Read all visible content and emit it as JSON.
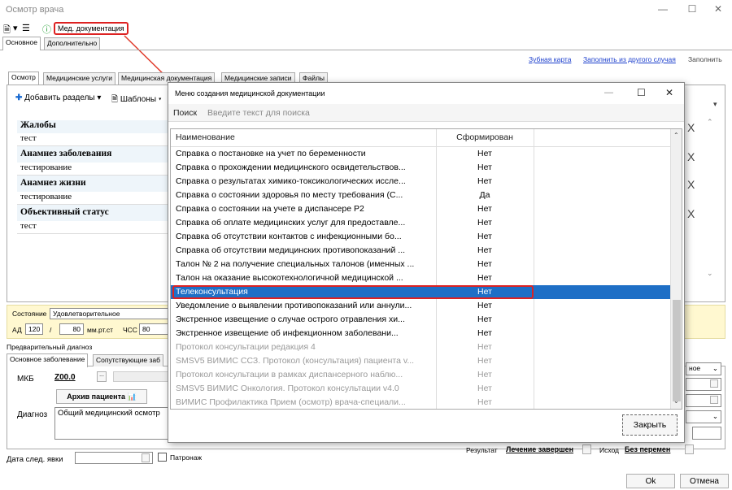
{
  "window": {
    "title": "Осмотр врача"
  },
  "toolbar": {
    "med_docs_label": "Мед. документация"
  },
  "main_tabs": [
    "Основное",
    "Дополнительно"
  ],
  "links": {
    "dental_map": "Зубная карта",
    "fill_from_other": "Заполнить из другого случая",
    "fill": "Заполнить"
  },
  "inner_tabs": [
    "Осмотр",
    "Медицинские услуги",
    "Медицинская документация",
    "Медицинские записи",
    "Файлы"
  ],
  "form_toolbar": {
    "add_sections": "Добавить разделы",
    "templates": "Шаблоны"
  },
  "sections": [
    {
      "head": "Жалобы",
      "value": "тест"
    },
    {
      "head": "Анамнез заболевания",
      "value": "тестирование"
    },
    {
      "head": "Анамнез жизни",
      "value": "тестирование"
    },
    {
      "head": "Объективный статус",
      "value": "тест"
    }
  ],
  "state": {
    "label": "Состояние",
    "value": "Удовлетворительное",
    "ad_label": "АД",
    "ad_sys": "120",
    "ad_sep": "/",
    "ad_dia": "80",
    "unit": "мм.рт.ст",
    "chss_label": "ЧСС",
    "chss_value": "80"
  },
  "diagnosis": {
    "title": "Предварительный диагноз",
    "tabs": [
      "Основное заболевание",
      "Сопутствующие заб"
    ],
    "mkb_label": "МКБ",
    "mkb_value": "Z00.0",
    "archive_button": "Архив пациента",
    "diag_label": "Диагноз",
    "diag_value": "Общий медицинский осмотр"
  },
  "right_panel": {
    "select_value": "ное"
  },
  "footer": {
    "next_visit_label": "Дата след. явки",
    "patronage_label": "Патронаж",
    "result_label": "Результат",
    "result_value": "Лечение завершен",
    "outcome_label": "Исход",
    "outcome_value": "Без перемен",
    "ok": "Ok",
    "cancel": "Отмена"
  },
  "dialog": {
    "title": "Меню создания медицинской документации",
    "search_label": "Поиск",
    "search_placeholder": "Введите текст для поиска",
    "col_name": "Наименование",
    "col_formed": "Сформирован",
    "close_button": "Закрыть",
    "rows": [
      {
        "name": "Справка о постановке на учет по беременности",
        "formed": "Нет"
      },
      {
        "name": "Справка о прохождении медицинского освидетельствов...",
        "formed": "Нет"
      },
      {
        "name": "Справка о результатах химико-токсикологических иссле...",
        "formed": "Нет"
      },
      {
        "name": "Справка о состоянии здоровья по месту требования (С...",
        "formed": "Да"
      },
      {
        "name": "Справка о состоянии на учете в диспансере Р2",
        "formed": "Нет"
      },
      {
        "name": "Справка об оплате медицинских услуг для предоставле...",
        "formed": "Нет"
      },
      {
        "name": "Справка об отсутствии контактов с инфекционными бо...",
        "formed": "Нет"
      },
      {
        "name": "Справка об отсутствии медицинских противопоказаний ...",
        "formed": "Нет"
      },
      {
        "name": "Талон № 2 на получение специальных талонов (именных ...",
        "formed": "Нет"
      },
      {
        "name": "Талон на оказание высокотехнологичной медицинской ...",
        "formed": "Нет"
      },
      {
        "name": "Телеконсультация",
        "formed": "Нет"
      },
      {
        "name": "Уведомление о выявлении противопоказаний или аннули...",
        "formed": "Нет"
      },
      {
        "name": "Экстренное извещение о случае острого отравления хи...",
        "formed": "Нет"
      },
      {
        "name": "Экстренное извещение об инфекционном заболевани...",
        "formed": "Нет"
      },
      {
        "name": "Протокол консультации редакция 4",
        "formed": "Нет"
      },
      {
        "name": "SMSV5 ВИМИС ССЗ. Протокол (консультация) пациента v...",
        "formed": "Нет"
      },
      {
        "name": "Протокол консультации в рамках диспансерного наблю...",
        "formed": "Нет"
      },
      {
        "name": "SMSV5 ВИМИС Онкология. Протокол консультации v4.0",
        "formed": "Нет"
      },
      {
        "name": "ВИМИС Профилактика Прием (осмотр) врача-специали...",
        "formed": "Нет"
      }
    ]
  },
  "colors": {
    "accent": "#1e6fc6",
    "highlight": "#d22222",
    "state_bg": "#fff8d0"
  }
}
